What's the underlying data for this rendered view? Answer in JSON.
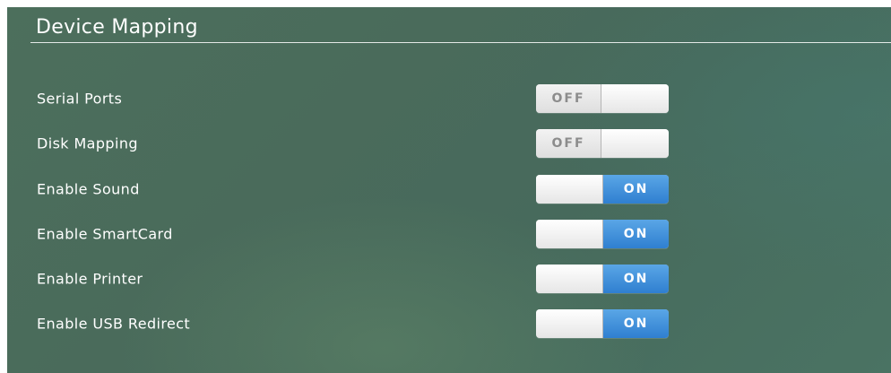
{
  "section": {
    "title": "Device Mapping"
  },
  "settings": [
    {
      "label": "Serial Ports",
      "state": "OFF"
    },
    {
      "label": "Disk Mapping",
      "state": "OFF"
    },
    {
      "label": "Enable Sound",
      "state": "ON"
    },
    {
      "label": "Enable SmartCard",
      "state": "ON"
    },
    {
      "label": "Enable Printer",
      "state": "ON"
    },
    {
      "label": "Enable USB Redirect",
      "state": "ON"
    }
  ],
  "colors": {
    "on_accent": "#2f7fd0",
    "panel_background": "#4a6b5b"
  }
}
